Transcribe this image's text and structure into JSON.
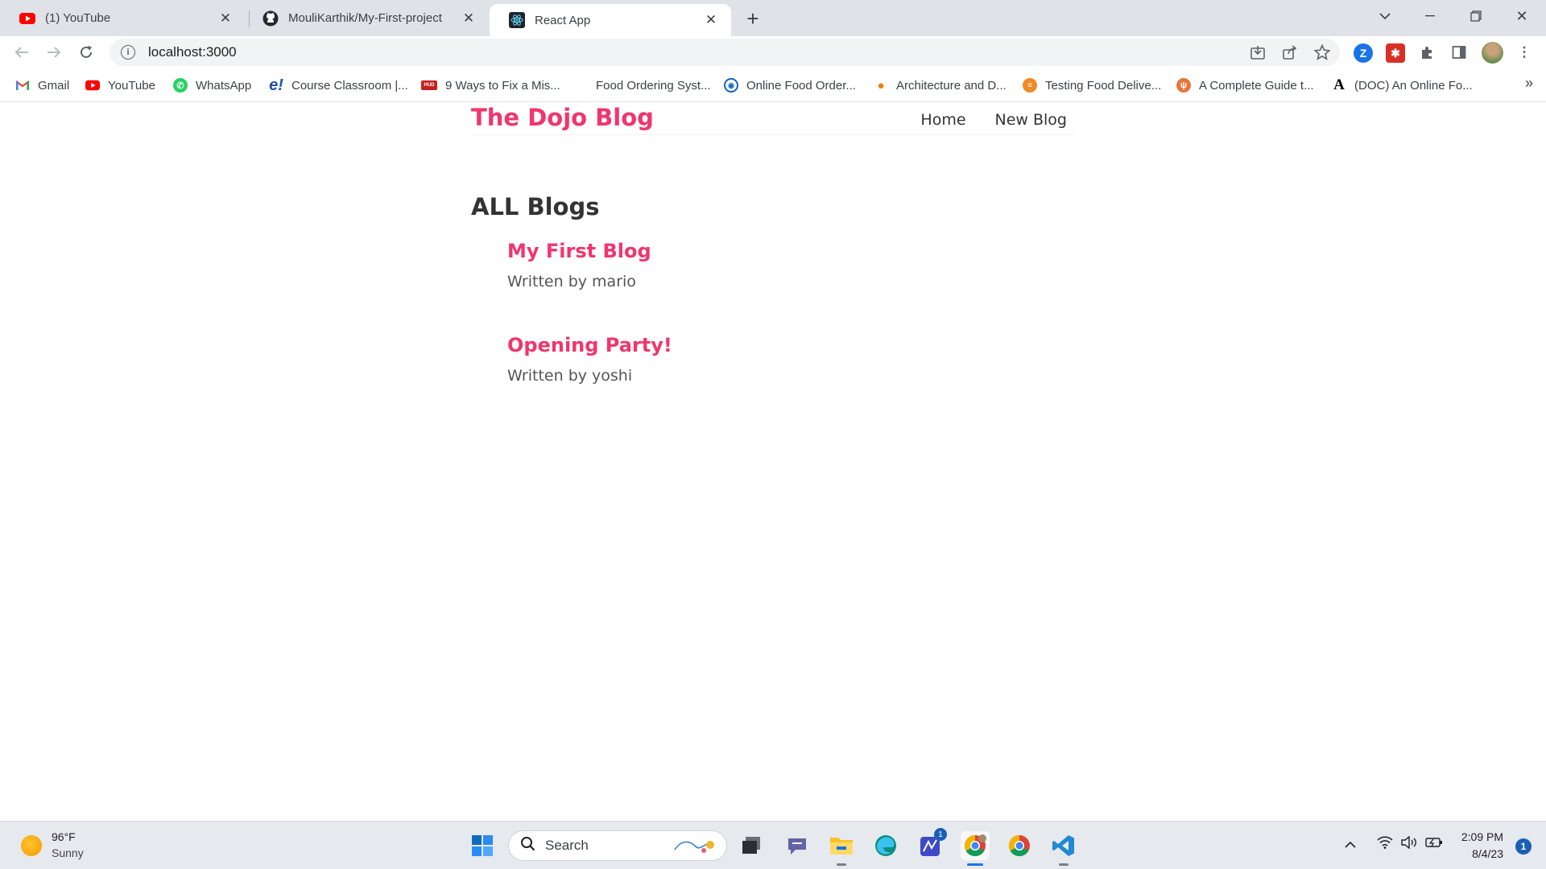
{
  "browser": {
    "tabs": [
      {
        "title": "(1) YouTube",
        "icon": "youtube-icon"
      },
      {
        "title": "MouliKarthik/My-First-project",
        "icon": "github-icon"
      },
      {
        "title": "React App",
        "icon": "react-icon"
      }
    ],
    "active_tab": 2,
    "url": "localhost:3000",
    "bookmarks": [
      {
        "label": "Gmail",
        "icon": "gmail-icon"
      },
      {
        "label": "YouTube",
        "icon": "youtube-icon"
      },
      {
        "label": "WhatsApp",
        "icon": "whatsapp-icon"
      },
      {
        "label": "Course Classroom |...",
        "icon": "course-icon"
      },
      {
        "label": "9 Ways to Fix a Mis...",
        "icon": "article-icon"
      },
      {
        "label": "Food Ordering Syst...",
        "icon": "blank-page-icon"
      },
      {
        "label": "Online Food Order...",
        "icon": "globe-icon"
      },
      {
        "label": "Architecture and D...",
        "icon": "pin-icon"
      },
      {
        "label": "Testing Food Delive...",
        "icon": "orange-circle-icon"
      },
      {
        "label": "A Complete Guide t...",
        "icon": "orange-logo-icon"
      },
      {
        "label": "(DOC) An Online Fo...",
        "icon": "academia-icon"
      }
    ]
  },
  "site": {
    "brand": "The Dojo Blog",
    "nav": {
      "home": "Home",
      "new_blog": "New Blog"
    },
    "heading": "ALL Blogs",
    "blogs": [
      {
        "title": "My First Blog",
        "author": "Written by mario"
      },
      {
        "title": "Opening Party!",
        "author": "Written by yoshi"
      }
    ],
    "colors": {
      "accent": "#f1356d",
      "text": "#333333"
    }
  },
  "taskbar": {
    "weather_temp": "96°F",
    "weather_cond": "Sunny",
    "search_label": "Search",
    "time": "2:09 PM",
    "date": "8/4/23",
    "notifications": "1",
    "teams_badge": "1"
  }
}
